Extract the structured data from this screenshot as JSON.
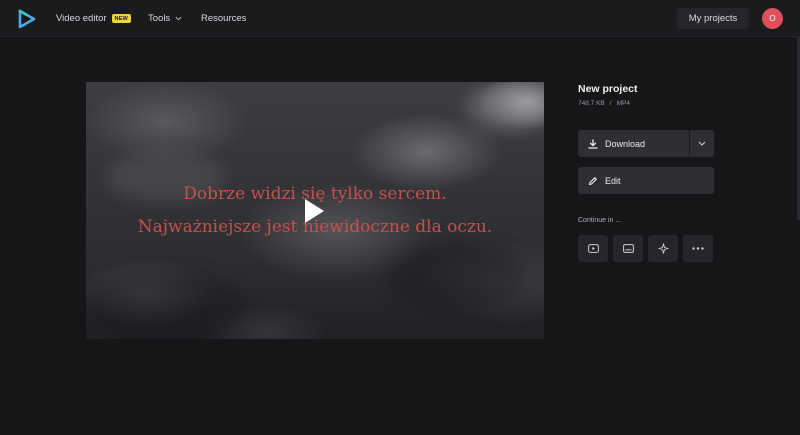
{
  "header": {
    "nav": {
      "video_editor": "Video editor",
      "video_editor_badge": "NEW",
      "tools": "Tools",
      "resources": "Resources"
    },
    "my_projects": "My projects",
    "avatar_initial": "O"
  },
  "video": {
    "caption_line1": "Dobrze widzi się tylko sercem.",
    "caption_line2": "Najważniejsze jest niewidoczne dla oczu.",
    "caption_color": "#c8504a"
  },
  "panel": {
    "title": "New project",
    "file_size": "748.7 KB",
    "separator": "/",
    "file_type": "MP4",
    "download_label": "Download",
    "edit_label": "Edit",
    "continue_label": "Continue in ...",
    "continue_icons": [
      "youtube-icon",
      "subtitles-icon",
      "sparkle-icon",
      "more-icon"
    ]
  },
  "colors": {
    "accent_badge": "#f1d240",
    "avatar": "#e0505a",
    "background": "#161618"
  }
}
